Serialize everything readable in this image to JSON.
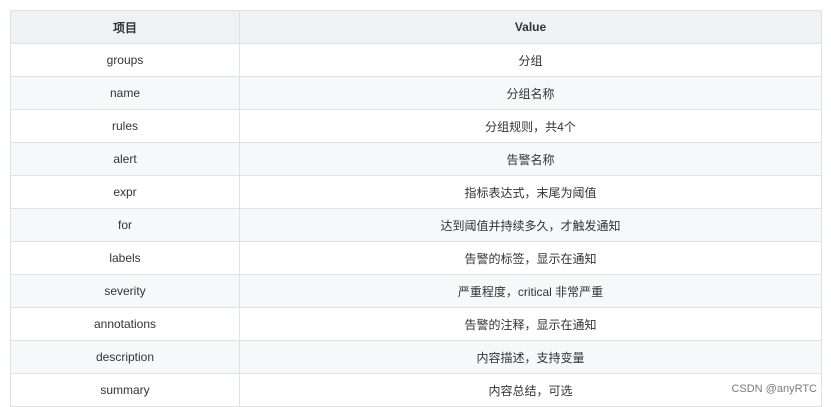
{
  "table": {
    "headers": [
      "项目",
      "Value"
    ],
    "rows": [
      {
        "key": "groups",
        "value": "分组"
      },
      {
        "key": "name",
        "value": "分组名称"
      },
      {
        "key": "rules",
        "value": "分组规则，共4个"
      },
      {
        "key": "alert",
        "value": "告警名称"
      },
      {
        "key": "expr",
        "value": "指标表达式，末尾为阈值"
      },
      {
        "key": "for",
        "value": "达到阈值并持续多久，才触发通知"
      },
      {
        "key": "labels",
        "value": "告警的标签，显示在通知"
      },
      {
        "key": "severity",
        "value": "严重程度，critical 非常严重"
      },
      {
        "key": "annotations",
        "value": "告警的注释，显示在通知"
      },
      {
        "key": "description",
        "value": "内容描述，支持变量"
      },
      {
        "key": "summary",
        "value": "内容总结，可选"
      }
    ]
  },
  "watermark": "CSDN @anyRTC"
}
